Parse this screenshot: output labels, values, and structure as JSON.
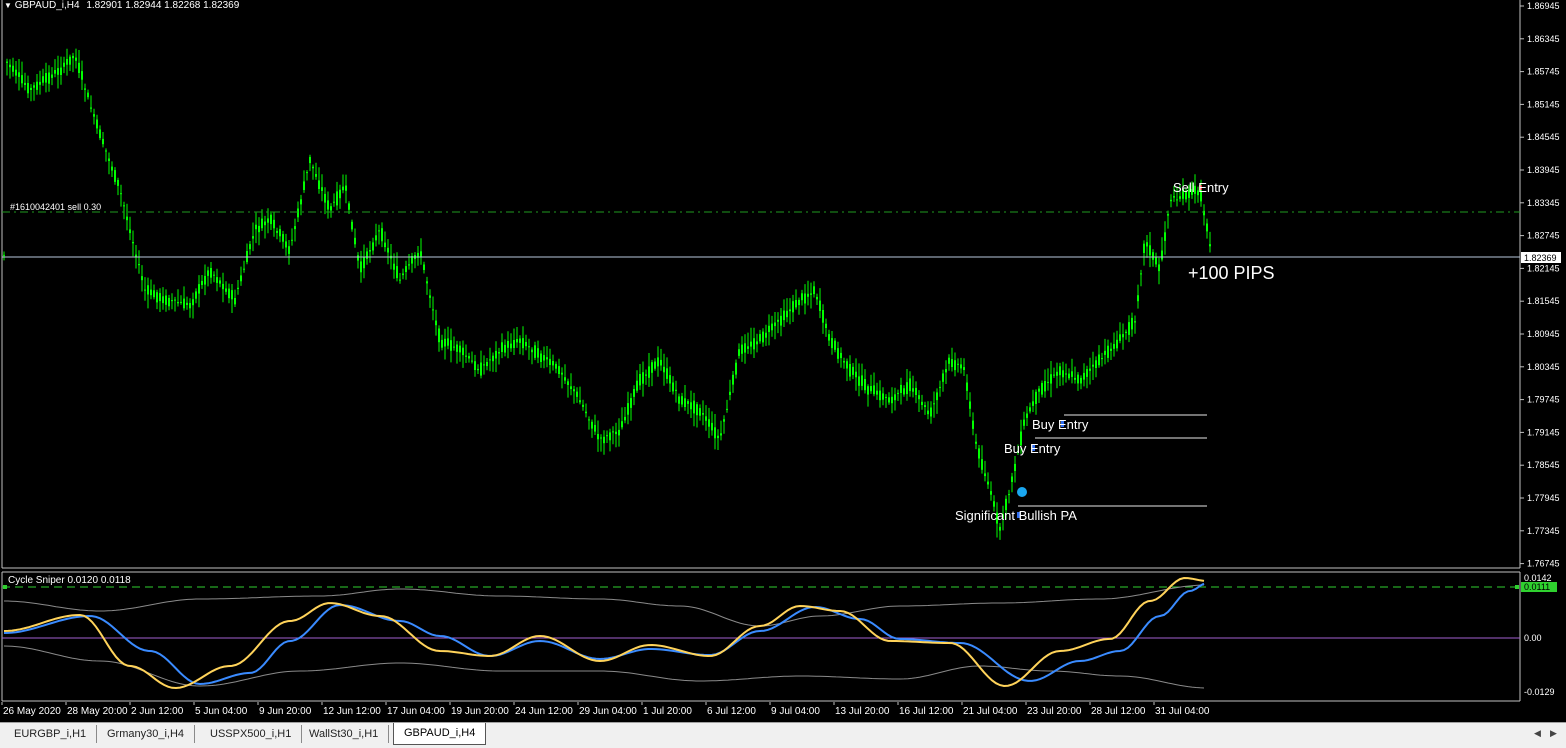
{
  "chart": {
    "symbol_header": "GBPAUD_i,H4",
    "ohlc_header": "1.82901 1.82944 1.82268 1.82369",
    "price_levels": [
      "1.86945",
      "1.86345",
      "1.85745",
      "1.85145",
      "1.84545",
      "1.83945",
      "1.83345",
      "1.82745",
      "1.82145",
      "1.81545",
      "1.80945",
      "1.80345",
      "1.79745",
      "1.79145",
      "1.78545",
      "1.77945",
      "1.77345",
      "1.76745"
    ],
    "current_price_label": "1.82369",
    "order_label": "#1610042401 sell 0.30",
    "annotations": {
      "sell_entry": "Sell Entry",
      "pips": "+100 PIPS",
      "buy_entry_1": "Buy Entry",
      "buy_entry_2": "Buy Entry",
      "significant": "Significant Bullish PA"
    },
    "colors": {
      "background": "#000000",
      "candles": "#00ff00",
      "grid_line": "#1f9a1f",
      "price_line": "#b9c8dc",
      "axis_text": "#ffffff"
    }
  },
  "indicator": {
    "title": "Cycle Sniper 0.0120 0.0118",
    "levels": [
      "0.0142",
      "0.00",
      "-0.0129"
    ],
    "value_badge": "0.0111",
    "colors": {
      "fast_line": "#ffd35a",
      "slow_line": "#3a8bff",
      "band": "#8a8a8a",
      "zero_line": "#a25fd0",
      "signal_line": "#2fd12f"
    }
  },
  "date_axis": [
    "26 May 2020",
    "28 May 20:00",
    "2 Jun 12:00",
    "5 Jun 04:00",
    "9 Jun 20:00",
    "12 Jun 12:00",
    "17 Jun 04:00",
    "19 Jun 20:00",
    "24 Jun 12:00",
    "29 Jun 04:00",
    "1 Jul 20:00",
    "6 Jul 12:00",
    "9 Jul 04:00",
    "13 Jul 20:00",
    "16 Jul 12:00",
    "21 Jul 04:00",
    "23 Jul 20:00",
    "28 Jul 12:00",
    "31 Jul 04:00"
  ],
  "tabs": [
    {
      "label": "EURGBP_i,H1",
      "active": false
    },
    {
      "label": "Grmany30_i,H4",
      "active": false
    },
    {
      "label": "USSPX500_i,H1",
      "active": false
    },
    {
      "label": "WallSt30_i,H1",
      "active": false
    },
    {
      "label": "GBPAUD_i,H4",
      "active": true
    }
  ]
}
